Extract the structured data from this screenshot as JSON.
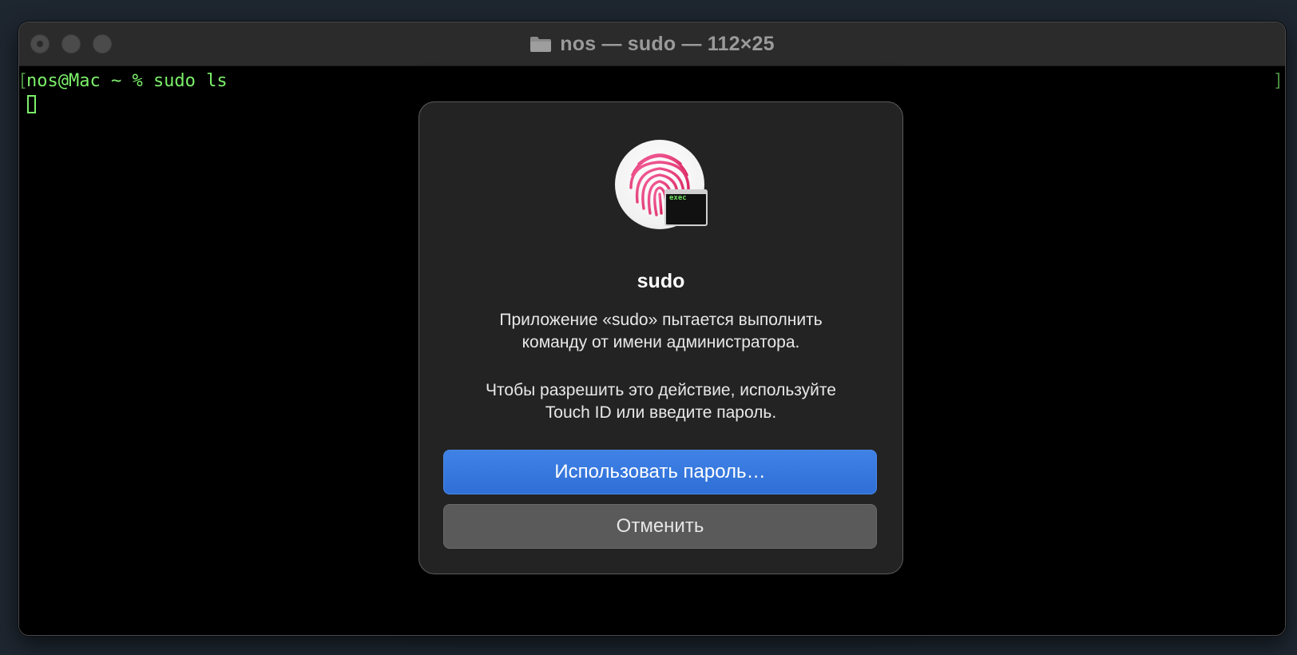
{
  "window": {
    "title": "nos — sudo — 112×25",
    "title_icon": "folder-icon"
  },
  "terminal": {
    "bracket_left": "[",
    "bracket_right": "]",
    "prompt": "nos@Mac ~ % sudo ls",
    "text_color": "#7cf06a"
  },
  "dialog": {
    "icon": "fingerprint-icon",
    "badge_label": "exec",
    "title": "sudo",
    "message_line1": "Приложение «sudo» пытается выполнить",
    "message_line2": "команду от имени администратора.",
    "hint_line1": "Чтобы разрешить это действие, используйте",
    "hint_line2": "Touch ID или введите пароль.",
    "primary_button": "Использовать пароль…",
    "cancel_button": "Отменить",
    "accent_color": "#3a7be0"
  }
}
